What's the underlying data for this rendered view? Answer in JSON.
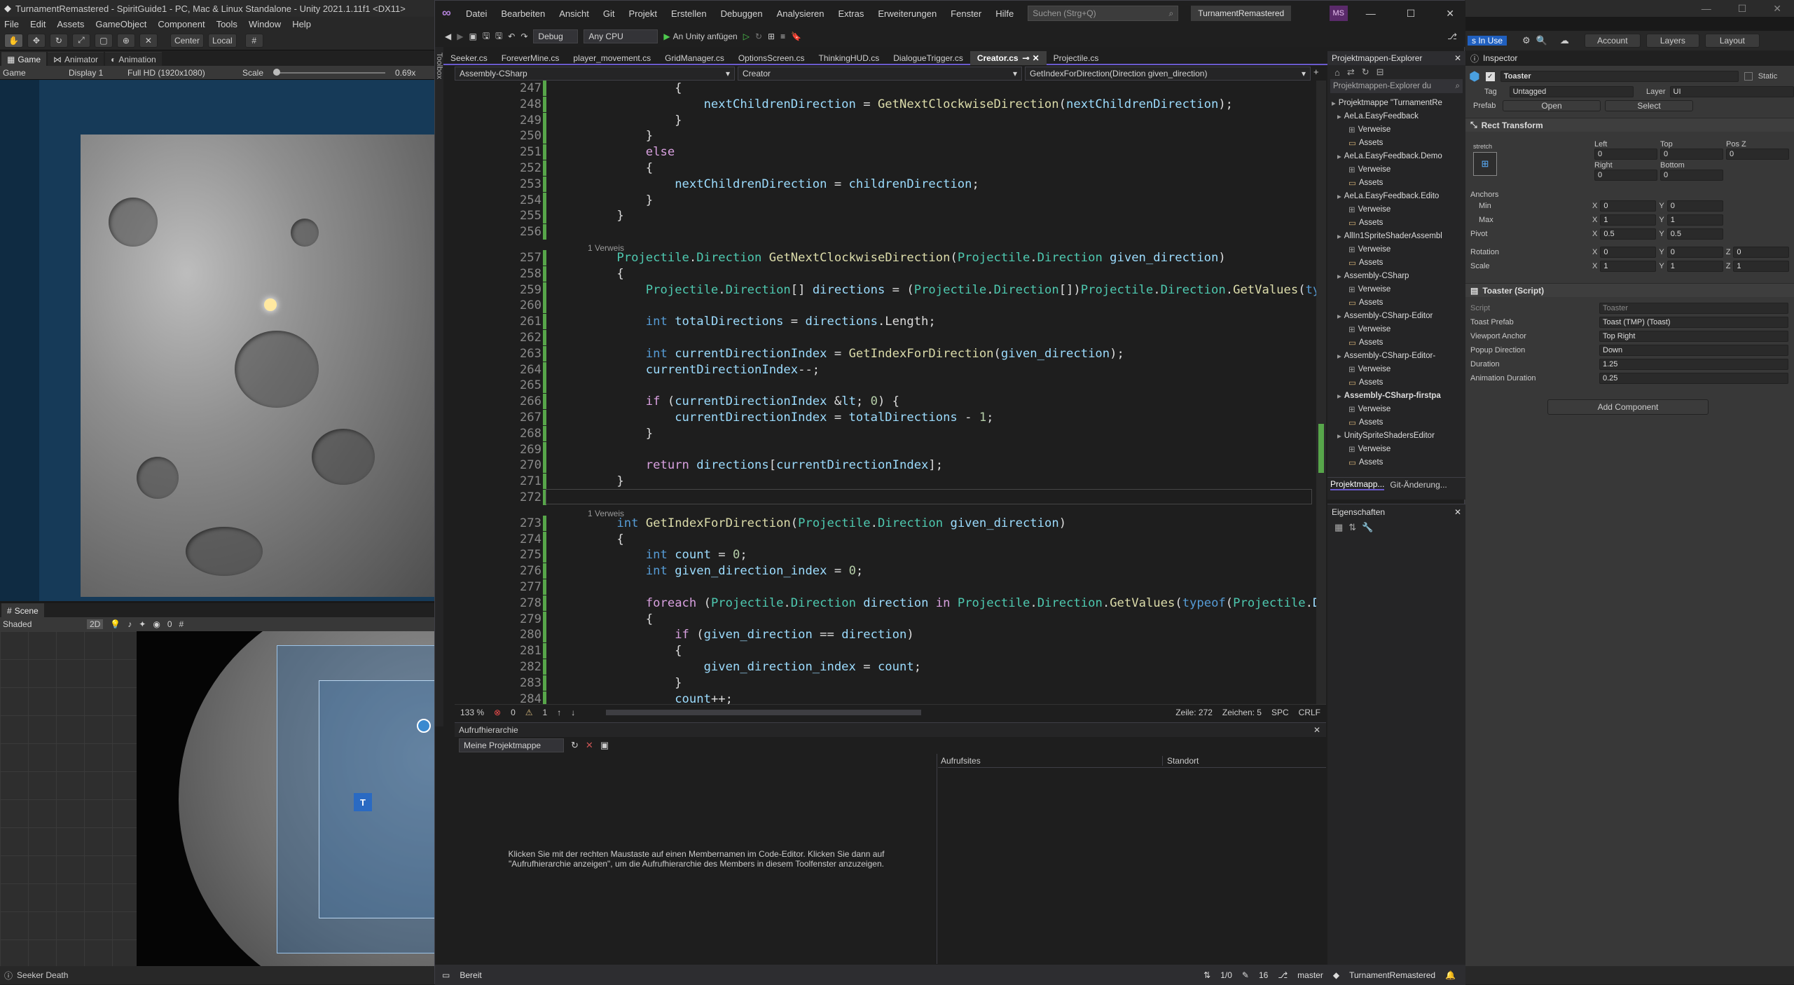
{
  "unity": {
    "title": "TurnamentRemastered - SpiritGuide1 - PC, Mac & Linux Standalone - Unity 2021.1.11f1 <DX11>",
    "menu": [
      "File",
      "Edit",
      "Assets",
      "GameObject",
      "Component",
      "Tools",
      "Window",
      "Help"
    ],
    "pivot": "Center",
    "space": "Local",
    "game_tabs": [
      "Game",
      "Animator",
      "Animation"
    ],
    "game_bar": {
      "mode": "Game",
      "display": "Display 1",
      "resolution": "Full HD (1920x1080)",
      "scale_label": "Scale",
      "scale_value": "0.69x"
    },
    "scene_tab": "Scene",
    "scene_mode": "Shaded",
    "scene_2d": "2D",
    "scene_count": "0",
    "status": "Seeker Death",
    "top_right": {
      "in_use": "s In Use",
      "account": "Account",
      "layers": "Layers",
      "layout": "Layout"
    },
    "inspector": {
      "tab": "Inspector",
      "object": "Toaster",
      "static": "Static",
      "tag_label": "Tag",
      "tag": "Untagged",
      "layer_label": "Layer",
      "layer": "UI",
      "prefab_label": "Prefab",
      "open": "Open",
      "select": "Select",
      "rect_transform": "Rect Transform",
      "stretch": "stretch",
      "left_label": "Left",
      "top_label": "Top",
      "posz_label": "Pos Z",
      "left": "0",
      "top": "0",
      "posz": "0",
      "right_label": "Right",
      "bottom_label": "Bottom",
      "right": "0",
      "bottom": "0",
      "anchors": "Anchors",
      "min": "Min",
      "max": "Max",
      "pivot": "Pivot",
      "min_x": "0",
      "min_y": "0",
      "max_x": "1",
      "max_y": "1",
      "pivot_x": "0.5",
      "pivot_y": "0.5",
      "rotation": "Rotation",
      "scale": "Scale",
      "rot_x": "0",
      "rot_y": "0",
      "rot_z": "0",
      "sc_x": "1",
      "sc_y": "1",
      "sc_z": "1",
      "script_comp": "Toaster (Script)",
      "script_label": "Script",
      "script_val": "Toaster",
      "toast_prefab_label": "Toast Prefab",
      "toast_prefab": "Toast (TMP) (Toast)",
      "viewport_anchor_label": "Viewport Anchor",
      "viewport_anchor": "Top Right",
      "popup_direction_label": "Popup Direction",
      "popup_direction": "Down",
      "duration_label": "Duration",
      "duration": "1.25",
      "anim_duration_label": "Animation Duration",
      "anim_duration": "0.25",
      "add_component": "Add Component"
    }
  },
  "vs": {
    "menu": [
      "Datei",
      "Bearbeiten",
      "Ansicht",
      "Git",
      "Projekt",
      "Erstellen",
      "Debuggen",
      "Analysieren",
      "Extras",
      "Erweiterungen",
      "Fenster",
      "Hilfe"
    ],
    "search": "Suchen (Strg+Q)",
    "solution": "TurnamentRemastered",
    "avatar": "MS",
    "config": "Debug",
    "platform": "Any CPU",
    "attach": "An Unity anfügen",
    "toolbox": "Toolbox",
    "tabs": [
      "Seeker.cs",
      "ForeverMine.cs",
      "player_movement.cs",
      "GridManager.cs",
      "OptionsScreen.cs",
      "ThinkingHUD.cs",
      "DialogueTrigger.cs",
      "Creator.cs",
      "Projectile.cs"
    ],
    "nav": {
      "project": "Assembly-CSharp",
      "class": "Creator",
      "member": "GetIndexForDirection(Direction given_direction)"
    },
    "editor_status": {
      "zoom": "133 %",
      "errors": "0",
      "warnings": "1",
      "line": "Zeile: 272",
      "char": "Zeichen: 5",
      "spc": "SPC",
      "crlf": "CRLF"
    },
    "callh": {
      "title": "Aufrufhierarchie",
      "scope": "Meine Projektmappe",
      "col1": "Aufrufsites",
      "col2": "Standort",
      "hint": "Klicken Sie mit der rechten Maustaste auf einen Membernamen im Code-Editor. Klicken Sie dann auf \"Aufrufhierarchie anzeigen\", um die Aufrufhierarchie des Members in diesem Toolfenster anzuzeigen."
    },
    "status": {
      "ready": "Bereit",
      "lines": "1/0",
      "pencil": "16",
      "branch": "master",
      "repo": "TurnamentRemastered"
    },
    "solex": {
      "title": "Projektmappen-Explorer",
      "search": "Projektmappen-Explorer du",
      "tab1": "Projektmapp...",
      "tab2": "Git-Änderung...",
      "props": "Eigenschaften",
      "items": [
        "Projektmappe \"TurnamentRe",
        "AeLa.EasyFeedback",
        "Verweise",
        "Assets",
        "AeLa.EasyFeedback.Demo",
        "Verweise",
        "Assets",
        "AeLa.EasyFeedback.Edito",
        "Verweise",
        "Assets",
        "AllIn1SpriteShaderAssembl",
        "Verweise",
        "Assets",
        "Assembly-CSharp",
        "Verweise",
        "Assets",
        "Assembly-CSharp-Editor",
        "Verweise",
        "Assets",
        "Assembly-CSharp-Editor-",
        "Verweise",
        "Assets",
        "Assembly-CSharp-firstpa",
        "Verweise",
        "Assets",
        "UnitySpriteShadersEditor",
        "Verweise",
        "Assets"
      ]
    },
    "refs": "1 Verweis",
    "code": [
      {
        "n": "247",
        "t": "            {"
      },
      {
        "n": "248",
        "t": "                nextChildrenDirection = GetNextClockwiseDirection(nextChildrenDirection);"
      },
      {
        "n": "249",
        "t": "            }"
      },
      {
        "n": "250",
        "t": "        }"
      },
      {
        "n": "251",
        "t": "        else"
      },
      {
        "n": "252",
        "t": "        {"
      },
      {
        "n": "253",
        "t": "            nextChildrenDirection = childrenDirection;"
      },
      {
        "n": "254",
        "t": "        }"
      },
      {
        "n": "255",
        "t": "    }"
      },
      {
        "n": "256",
        "t": ""
      },
      {
        "n": "257",
        "t": "    Projectile.Direction GetNextClockwiseDirection(Projectile.Direction given_direction)"
      },
      {
        "n": "258",
        "t": "    {"
      },
      {
        "n": "259",
        "t": "        Projectile.Direction[] directions = (Projectile.Direction[])Projectile.Direction.GetValues(typeof("
      },
      {
        "n": "260",
        "t": ""
      },
      {
        "n": "261",
        "t": "        int totalDirections = directions.Length;"
      },
      {
        "n": "262",
        "t": ""
      },
      {
        "n": "263",
        "t": "        int currentDirectionIndex = GetIndexForDirection(given_direction);"
      },
      {
        "n": "264",
        "t": "        currentDirectionIndex--;"
      },
      {
        "n": "265",
        "t": ""
      },
      {
        "n": "266",
        "t": "        if (currentDirectionIndex < 0) {"
      },
      {
        "n": "267",
        "t": "            currentDirectionIndex = totalDirections - 1;"
      },
      {
        "n": "268",
        "t": "        }"
      },
      {
        "n": "269",
        "t": ""
      },
      {
        "n": "270",
        "t": "        return directions[currentDirectionIndex];"
      },
      {
        "n": "271",
        "t": "    }"
      },
      {
        "n": "272",
        "t": ""
      },
      {
        "n": "273",
        "t": "    int GetIndexForDirection(Projectile.Direction given_direction)"
      },
      {
        "n": "274",
        "t": "    {"
      },
      {
        "n": "275",
        "t": "        int count = 0;"
      },
      {
        "n": "276",
        "t": "        int given_direction_index = 0;"
      },
      {
        "n": "277",
        "t": ""
      },
      {
        "n": "278",
        "t": "        foreach (Projectile.Direction direction in Projectile.Direction.GetValues(typeof(Projectile.Direct"
      },
      {
        "n": "279",
        "t": "        {"
      },
      {
        "n": "280",
        "t": "            if (given_direction == direction)"
      },
      {
        "n": "281",
        "t": "            {"
      },
      {
        "n": "282",
        "t": "                given_direction_index = count;"
      },
      {
        "n": "283",
        "t": "            }"
      },
      {
        "n": "284",
        "t": "            count++;"
      }
    ]
  }
}
